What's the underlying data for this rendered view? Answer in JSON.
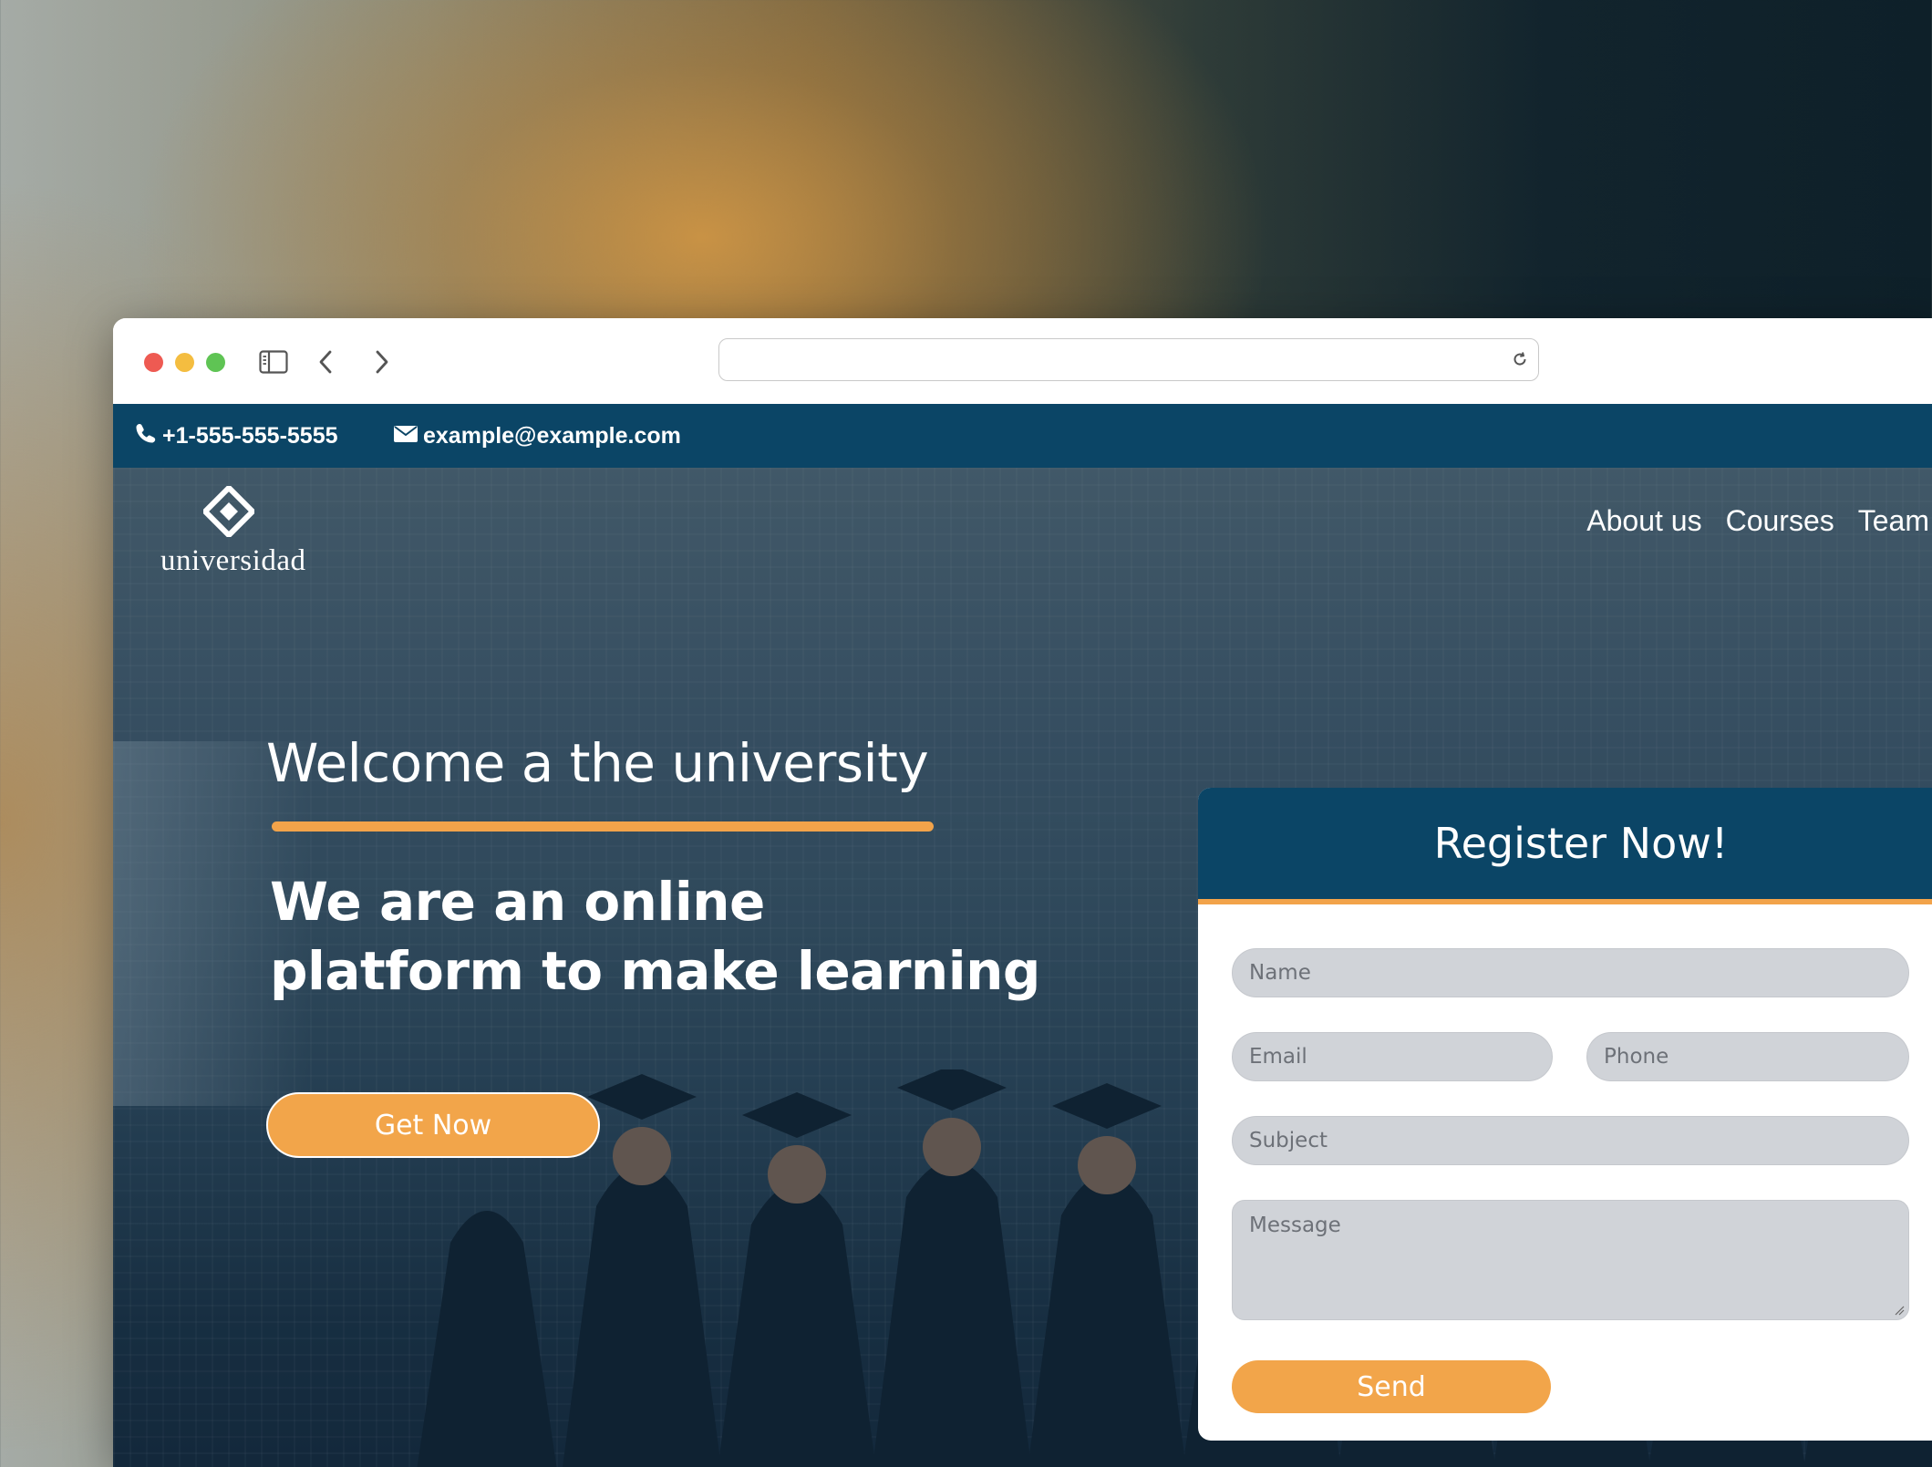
{
  "browser": {
    "address": "",
    "icons": [
      "sidebar-icon",
      "back-arrow-icon",
      "forward-arrow-icon",
      "reload-icon"
    ]
  },
  "topbar": {
    "phone": "+1-555-555-5555",
    "email": "example@example.com"
  },
  "logo": {
    "text": "universidad"
  },
  "nav": {
    "items": [
      "About us",
      "Courses",
      "Team"
    ]
  },
  "hero": {
    "welcome": "Welcome a the university",
    "tagline_line1": "We are an online",
    "tagline_line2": "platform to make learning",
    "cta": "Get Now"
  },
  "form": {
    "title": "Register Now!",
    "name_placeholder": "Name",
    "email_placeholder": "Email",
    "phone_placeholder": "Phone",
    "subject_placeholder": "Subject",
    "message_placeholder": "Message",
    "send": "Send"
  },
  "colors": {
    "brand_navy": "#0b4566",
    "accent_orange": "#f2a54a",
    "field_gray": "#d0d3d8"
  }
}
